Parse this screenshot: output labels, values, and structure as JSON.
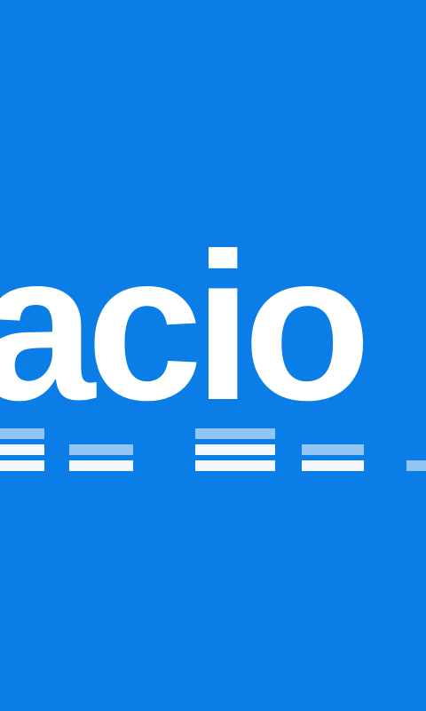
{
  "splash": {
    "background_color": "#0a7ee6",
    "foreground_color": "#ffffff",
    "brand_text": "acio",
    "equalizer": {
      "icon": "equalizer-bars",
      "columns": [
        {
          "levels": 3
        },
        {
          "levels": 2
        },
        {
          "levels": 3
        },
        {
          "levels": 2
        },
        {
          "levels": 1
        }
      ]
    }
  }
}
